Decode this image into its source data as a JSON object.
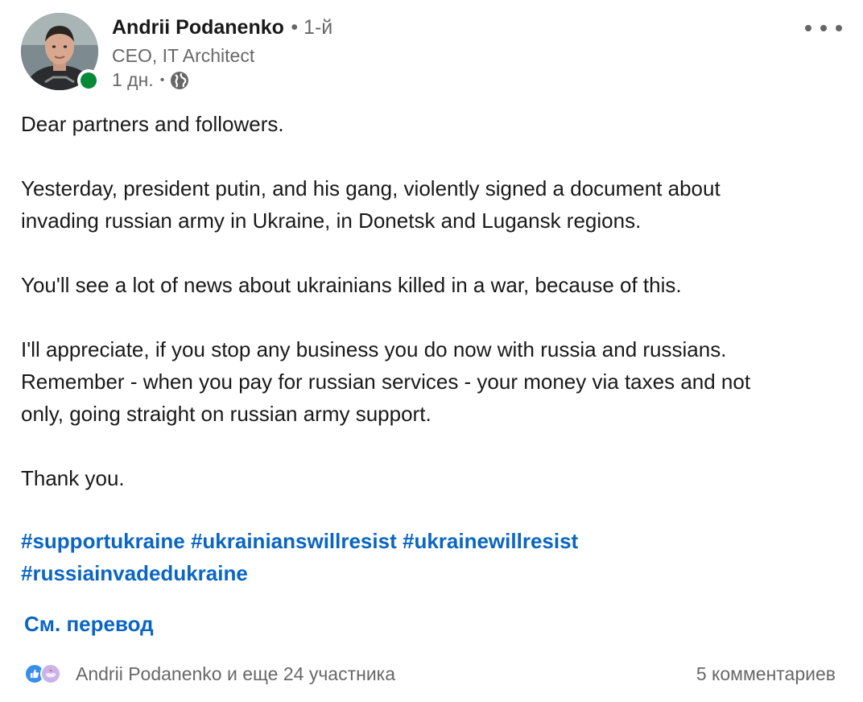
{
  "author": {
    "name": "Andrii Podanenko",
    "degree": "• 1-й",
    "headline": "CEO, IT Architect",
    "time": "1 дн.",
    "separator": "•",
    "visibility_icon": "globe-icon",
    "status": "online"
  },
  "post": {
    "paragraphs": [
      [
        "Dear partners and followers."
      ],
      [
        "Yesterday, president putin, and his gang, violently signed a document about",
        "invading russian army in Ukraine, in Donetsk and Lugansk regions."
      ],
      [
        "You'll see a lot of news about ukrainians killed in a war, because of this."
      ],
      [
        "I'll appreciate, if you stop any business you do now with russia and russians.",
        "Remember - when you pay for russian services - your money via taxes and not",
        "only, going straight on russian army support."
      ],
      [
        "Thank you."
      ]
    ],
    "hashtags": [
      "#supportukraine",
      "#ukrainianswillresist",
      "#ukrainewillresist",
      "#russiainvadedukraine"
    ],
    "translate_label": "См. перевод"
  },
  "social": {
    "reactions_text": "Andrii Podanenko и еще 24 участника",
    "reaction_icons": [
      "like-icon",
      "support-icon"
    ],
    "comments_text": "5 комментариев"
  },
  "colors": {
    "link": "#0a66c2",
    "presence": "#058a37",
    "secondary_text": "#666666"
  }
}
